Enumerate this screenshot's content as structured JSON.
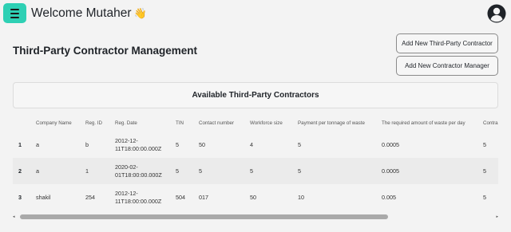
{
  "header": {
    "welcome": "Welcome Mutaher",
    "wave_emoji": "👋"
  },
  "page": {
    "title": "Third-Party Contractor Management"
  },
  "actions": {
    "add_contractor": "Add New Third-Party Contractor",
    "add_manager": "Add New Contractor Manager"
  },
  "card": {
    "title": "Available Third-Party Contractors"
  },
  "table": {
    "columns": [
      "Company Name",
      "Reg. ID",
      "Reg. Date",
      "TIN",
      "Contact number",
      "Workforce size",
      "Payment per tonnage of waste",
      "The required amount of waste per day",
      "Contra"
    ],
    "rows": [
      {
        "index": "1",
        "company": "a",
        "reg_id": "b",
        "reg_date": "2012-12-11T18:00:00.000Z",
        "tin": "5",
        "contact": "50",
        "workforce": "4",
        "payment": "5",
        "waste": "0.0005",
        "contract": "5"
      },
      {
        "index": "2",
        "company": "a",
        "reg_id": "1",
        "reg_date": "2020-02-01T18:00:00.000Z",
        "tin": "5",
        "contact": "5",
        "workforce": "5",
        "payment": "5",
        "waste": "0.0005",
        "contract": "5"
      },
      {
        "index": "3",
        "company": "shakil",
        "reg_id": "254",
        "reg_date": "2012-12-11T18:00:00.000Z",
        "tin": "504",
        "contact": "017",
        "workforce": "50",
        "payment": "10",
        "waste": "0.005",
        "contract": "5"
      }
    ]
  },
  "scrollbar": {
    "left_arrow": "◂",
    "right_arrow": "▸",
    "position": 0,
    "visible_fraction": 0.76
  },
  "colors": {
    "accent": "#2ed0b4",
    "background": "#f3f3f3"
  },
  "icons": {
    "menu": "hamburger-menu-icon",
    "user": "user-circle-icon"
  }
}
